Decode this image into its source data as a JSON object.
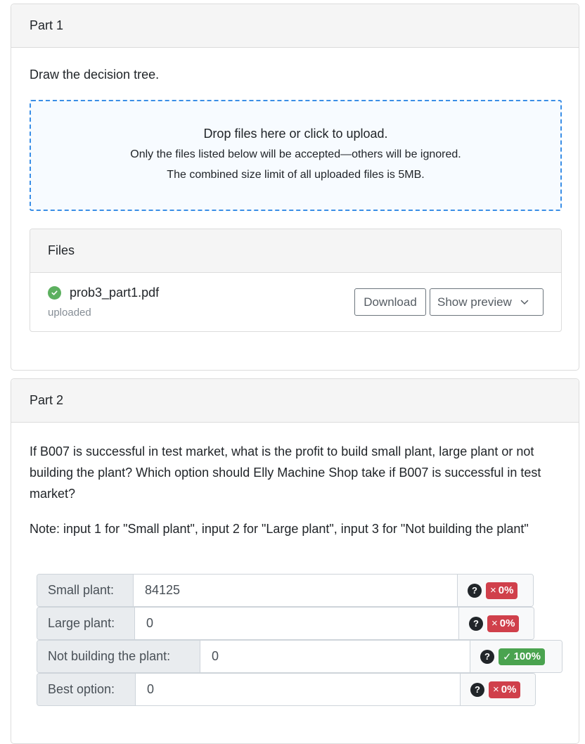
{
  "part1": {
    "title": "Part 1",
    "instruction": "Draw the decision tree.",
    "dropzone": {
      "main": "Drop files here or click to upload.",
      "sub1": "Only the files listed below will be accepted—others will be ignored.",
      "sub2": "The combined size limit of all uploaded files is 5MB."
    },
    "files": {
      "title": "Files",
      "items": [
        {
          "name": "prob3_part1.pdf",
          "status": "uploaded",
          "status_icon": "check-circle-icon",
          "download_label": "Download",
          "preview_label": "Show preview"
        }
      ]
    }
  },
  "part2": {
    "title": "Part 2",
    "question": "If B007 is successful in test market, what is the profit to build small plant, large plant or not building the plant? Which option should Elly Machine Shop take if B007 is successful in test market?",
    "note": "Note: input 1 for \"Small plant\", input 2 for \"Large plant\", input 3 for \"Not building the plant\"",
    "inputs": [
      {
        "label": "Small plant:",
        "value": "84125",
        "help": "?",
        "score_mark": "×",
        "score": "0%",
        "status": "incorrect",
        "color": "#d0404b"
      },
      {
        "label": "Large plant:",
        "value": "0",
        "help": "?",
        "score_mark": "×",
        "score": "0%",
        "status": "incorrect",
        "color": "#d0404b"
      },
      {
        "label": "Not building the plant:",
        "value": "0",
        "help": "?",
        "score_mark": "✓",
        "score": "100%",
        "status": "correct",
        "color": "#4aa34f"
      },
      {
        "label": "Best option:",
        "value": "0",
        "help": "?",
        "score_mark": "×",
        "score": "0%",
        "status": "incorrect",
        "color": "#d0404b"
      }
    ]
  },
  "colors": {
    "dropzone_border": "#3a8ee6",
    "success": "#5cb05f",
    "badge_correct": "#4aa34f",
    "badge_incorrect": "#d0404b"
  }
}
